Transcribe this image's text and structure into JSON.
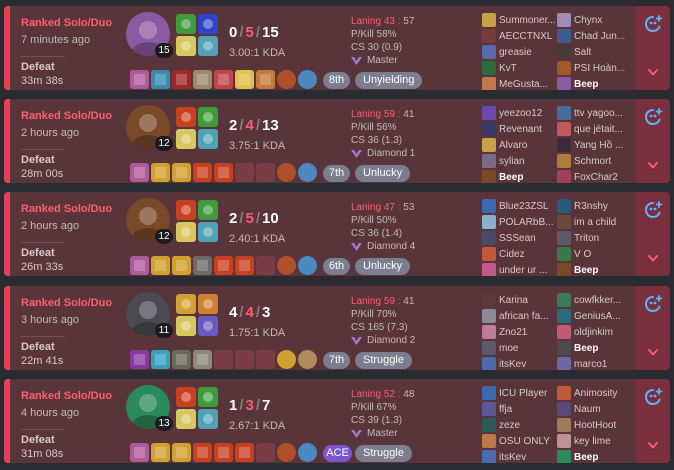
{
  "matches": [
    {
      "queue": "Ranked Solo/Duo",
      "ago": "7 minutes ago",
      "result": "Defeat",
      "duration": "33m 38s",
      "level": "15",
      "k": "0",
      "d": "5",
      "a": "15",
      "kda": "3.00:1 KDA",
      "laning_label": "Laning",
      "laning_a": "43",
      "laning_b": "57",
      "pkill": "P/Kill 58%",
      "cs": "CS 30 (0.9)",
      "rank": "Master",
      "position": "8th",
      "tag": "Unyielding",
      "ace": false,
      "champ_color": "#8c5aa0",
      "spell1": "#3f9a3c",
      "spell2": "#2b45c8",
      "rune1": "#d8c75e",
      "rune2": "#4fa3b5",
      "items": [
        "#b05a9a",
        "#3a8bb0",
        "#a02828",
        "#9a8b6a",
        "#c04646",
        "#e0c050",
        "#c57a3a"
      ],
      "trinket": "#b0502a",
      "extra": "#4a8ac0",
      "players_left": [
        {
          "name": "Summoner...",
          "color": "#c8a048",
          "me": false
        },
        {
          "name": "AECCTNXL",
          "color": "#7a3c3a",
          "me": false
        },
        {
          "name": "greasie",
          "color": "#5a6ab0",
          "me": false
        },
        {
          "name": "KvT",
          "color": "#2f6a3c",
          "me": false
        },
        {
          "name": "MeGusta...",
          "color": "#c07a4a",
          "me": false
        }
      ],
      "players_right": [
        {
          "name": "Chynx",
          "color": "#a08ab8",
          "me": false
        },
        {
          "name": "Chad Jun...",
          "color": "#3c5a8a",
          "me": false
        },
        {
          "name": "Salt",
          "color": "#4a3a3a",
          "me": false
        },
        {
          "name": "PSI Hoàn...",
          "color": "#a05a2a",
          "me": false
        },
        {
          "name": "Beep",
          "color": "#8c5aa0",
          "me": true
        }
      ]
    },
    {
      "queue": "Ranked Solo/Duo",
      "ago": "2 hours ago",
      "result": "Defeat",
      "duration": "28m 00s",
      "level": "12",
      "k": "2",
      "d": "4",
      "a": "13",
      "kda": "3.75:1 KDA",
      "laning_label": "Laning",
      "laning_a": "59",
      "laning_b": "41",
      "pkill": "P/Kill 56%",
      "cs": "CS 36 (1.3)",
      "rank": "Diamond 1",
      "position": "7th",
      "tag": "Unlucky",
      "ace": false,
      "champ_color": "#7a4a28",
      "spell1": "#c84020",
      "spell2": "#3f9a3c",
      "rune1": "#d8c75e",
      "rune2": "#4fa3b5",
      "items": [
        "#b05a9a",
        "#d0a030",
        "#d0a030",
        "#c84020",
        "#c84020",
        "",
        ""
      ],
      "trinket": "#b0502a",
      "extra": "#4a8ac0",
      "players_left": [
        {
          "name": "yeezoo12",
          "color": "#6a4ab0",
          "me": false
        },
        {
          "name": "Revenant",
          "color": "#3a3a6a",
          "me": false
        },
        {
          "name": "Alvaro",
          "color": "#c8a048",
          "me": false
        },
        {
          "name": "sylian",
          "color": "#7a6a8a",
          "me": false
        },
        {
          "name": "Beep",
          "color": "#7a4a28",
          "me": true
        }
      ],
      "players_right": [
        {
          "name": "ttv yagoo...",
          "color": "#4a6a9a",
          "me": false
        },
        {
          "name": "que jétait...",
          "color": "#c05a5a",
          "me": false
        },
        {
          "name": "Yang Hồ ...",
          "color": "#3a2a3a",
          "me": false
        },
        {
          "name": "Schmort",
          "color": "#b07a3a",
          "me": false
        },
        {
          "name": "FoxChar2",
          "color": "#a0405a",
          "me": false
        }
      ]
    },
    {
      "queue": "Ranked Solo/Duo",
      "ago": "2 hours ago",
      "result": "Defeat",
      "duration": "26m 33s",
      "level": "12",
      "k": "2",
      "d": "5",
      "a": "10",
      "kda": "2.40:1 KDA",
      "laning_label": "Laning",
      "laning_a": "47",
      "laning_b": "53",
      "pkill": "P/Kill 50%",
      "cs": "CS 36 (1.4)",
      "rank": "Diamond 4",
      "position": "6th",
      "tag": "Unlucky",
      "ace": false,
      "champ_color": "#7a4a28",
      "spell1": "#c84020",
      "spell2": "#3f9a3c",
      "rune1": "#d8c75e",
      "rune2": "#4fa3b5",
      "items": [
        "#b05a9a",
        "#d0a030",
        "#d0a030",
        "#6a6a6a",
        "#c84020",
        "#c84020",
        ""
      ],
      "trinket": "#b0502a",
      "extra": "#4a8ac0",
      "players_left": [
        {
          "name": "Blue23ZSL",
          "color": "#3a6ab0",
          "me": false
        },
        {
          "name": "POLARbB...",
          "color": "#8ab0d0",
          "me": false
        },
        {
          "name": "SSSean",
          "color": "#4a4a6a",
          "me": false
        },
        {
          "name": "Cidez",
          "color": "#c05a3a",
          "me": false
        },
        {
          "name": "under ur ...",
          "color": "#c05a8a",
          "me": false
        }
      ],
      "players_right": [
        {
          "name": "R3nshy",
          "color": "#2a5a7a",
          "me": false
        },
        {
          "name": "im a child",
          "color": "#6a4a3a",
          "me": false
        },
        {
          "name": "Triton",
          "color": "#5a5a6a",
          "me": false
        },
        {
          "name": "V O",
          "color": "#3a7a4a",
          "me": false
        },
        {
          "name": "Beep",
          "color": "#7a4a28",
          "me": true
        }
      ]
    },
    {
      "queue": "Ranked Solo/Duo",
      "ago": "3 hours ago",
      "result": "Defeat",
      "duration": "22m 41s",
      "level": "11",
      "k": "4",
      "d": "4",
      "a": "3",
      "kda": "1.75:1 KDA",
      "laning_label": "Laning",
      "laning_a": "59",
      "laning_b": "41",
      "pkill": "P/Kill 70%",
      "cs": "CS 165 (7.3)",
      "rank": "Diamond 2",
      "position": "7th",
      "tag": "Struggle",
      "ace": false,
      "champ_color": "#4a4a50",
      "spell1": "#d0a030",
      "spell2": "#d08030",
      "rune1": "#d8c75e",
      "rune2": "#6a5ac0",
      "items": [
        "#8a3aa0",
        "#3aa0c0",
        "#6a6a5a",
        "#8a8a7a",
        "",
        "",
        ""
      ],
      "trinket": "#d0a030",
      "extra": "#b08a5a",
      "players_left": [
        {
          "name": "Karina",
          "color": "#5a3a3a",
          "me": false
        },
        {
          "name": "african fa...",
          "color": "#8a8a9a",
          "me": false
        },
        {
          "name": "Zno21",
          "color": "#c07a9a",
          "me": false
        },
        {
          "name": "moe",
          "color": "#5a5a6a",
          "me": false
        },
        {
          "name": "itsKev",
          "color": "#4a6ab0",
          "me": false
        }
      ],
      "players_right": [
        {
          "name": "cowfkker...",
          "color": "#3a7a5a",
          "me": false
        },
        {
          "name": "GeniusA...",
          "color": "#2a6a7a",
          "me": false
        },
        {
          "name": "oldjinkim",
          "color": "#c05a7a",
          "me": false
        },
        {
          "name": "Beep",
          "color": "#4a4a50",
          "me": true
        },
        {
          "name": "marco1",
          "color": "#6a6aa0",
          "me": false
        }
      ]
    },
    {
      "queue": "Ranked Solo/Duo",
      "ago": "4 hours ago",
      "result": "Defeat",
      "duration": "31m 08s",
      "level": "13",
      "k": "1",
      "d": "3",
      "a": "7",
      "kda": "2.67:1 KDA",
      "laning_label": "Laning",
      "laning_a": "52",
      "laning_b": "48",
      "pkill": "P/Kill 67%",
      "cs": "CS 39 (1.3)",
      "rank": "Master",
      "position": "ACE",
      "tag": "Struggle",
      "ace": true,
      "champ_color": "#2a8a5a",
      "spell1": "#c84020",
      "spell2": "#3f9a3c",
      "rune1": "#d8c75e",
      "rune2": "#4fa3b5",
      "items": [
        "#b05a9a",
        "#d0a030",
        "#d0a030",
        "#c84020",
        "#c84020",
        "#c84020",
        ""
      ],
      "trinket": "#b0502a",
      "extra": "#4a8ac0",
      "players_left": [
        {
          "name": "ICU Player",
          "color": "#3a6ab0",
          "me": false
        },
        {
          "name": "ffja",
          "color": "#5a5a9a",
          "me": false
        },
        {
          "name": "zeze",
          "color": "#2a5a5a",
          "me": false
        },
        {
          "name": "OSU ONLY",
          "color": "#c07a4a",
          "me": false
        },
        {
          "name": "itsKev",
          "color": "#4a6ab0",
          "me": false
        }
      ],
      "players_right": [
        {
          "name": "Animosity",
          "color": "#c05a3a",
          "me": false
        },
        {
          "name": "Naum",
          "color": "#5a4a7a",
          "me": false
        },
        {
          "name": "HootHoot",
          "color": "#a07a5a",
          "me": false
        },
        {
          "name": "key lime",
          "color": "#c0909a",
          "me": false
        },
        {
          "name": "Beep",
          "color": "#2a8a5a",
          "me": true
        }
      ]
    }
  ],
  "icons": {
    "expand": "add-friend-plus-icon",
    "collapse": "chevron-down-icon",
    "rank": "rank-wings-icon"
  },
  "colors": {
    "loss_accent": "#e84057",
    "card_bg": "#59343b",
    "control_bg": "#7a2f3c",
    "ace_badge": "#7a55d6",
    "plain_badge": "#7a7e8e",
    "expand_icon": "#59b5ff",
    "chevron": "#ff5f6d"
  }
}
